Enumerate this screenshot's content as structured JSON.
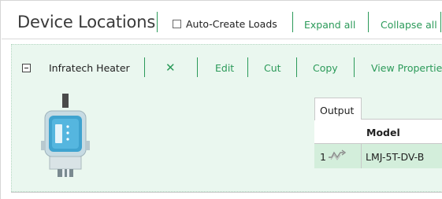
{
  "header": {
    "title": "Device Locations",
    "auto_create_label": "Auto-Create Loads",
    "auto_create_checked": false,
    "expand_all": "Expand all",
    "collapse_all": "Collapse all"
  },
  "device_card": {
    "name": "Infratech Heater",
    "delete_icon": "x-icon",
    "actions": {
      "edit": "Edit",
      "cut": "Cut",
      "copy": "Copy",
      "view_properties": "View Propertie"
    },
    "output_tab": "Output",
    "table": {
      "columns": [
        "Model"
      ],
      "rows": [
        {
          "number": "1",
          "icon": "wire-link-icon",
          "model": "LMJ-5T-DV-B"
        }
      ]
    }
  },
  "colors": {
    "accent_green": "#2b9a59",
    "card_background": "#eaf7ef",
    "row_highlight": "#d3eedb"
  }
}
